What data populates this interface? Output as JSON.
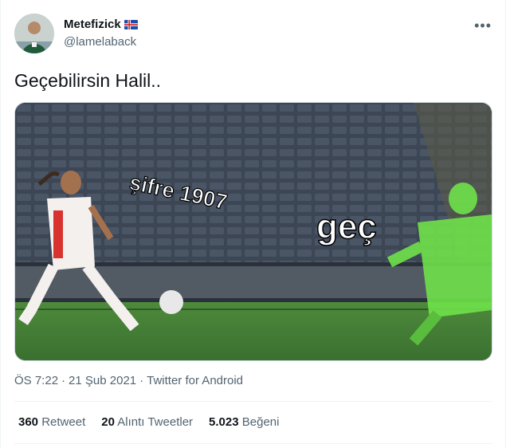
{
  "author": {
    "display_name": "Metefizick",
    "handle": "@lamelaback",
    "flag_icon": "iceland-flag-icon"
  },
  "more_icon": "more-horizontal-icon",
  "tweet": {
    "text": "Geçebilirsin Halil..",
    "media": {
      "caption_player": "şifre 1907",
      "caption_keeper": "geç"
    }
  },
  "meta": {
    "time": "ÖS 7:22",
    "date": "21 Şub 2021",
    "separator": "·",
    "source": "Twitter for Android"
  },
  "stats": [
    {
      "count": "360",
      "label": "Retweet"
    },
    {
      "count": "20",
      "label": "Alıntı Tweetler"
    },
    {
      "count": "5.023",
      "label": "Beğeni"
    }
  ],
  "colors": {
    "text": "#0f1419",
    "secondary": "#536471",
    "divider": "#eff3f4",
    "pitch": "#3f7a33",
    "keeper": "#6fe24a",
    "jersey_red": "#d8332e"
  }
}
